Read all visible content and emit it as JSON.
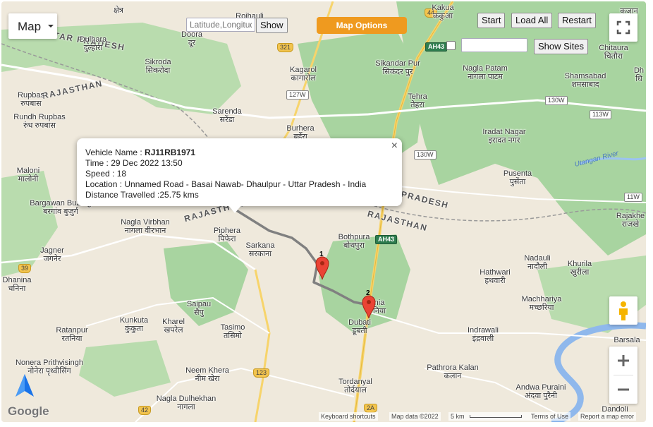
{
  "map_type": {
    "label": "Map"
  },
  "latlong_input": {
    "placeholder": "Latitude,Longitude"
  },
  "show_button": {
    "label": "Show"
  },
  "map_options_button": {
    "label": "Map Options"
  },
  "playback": {
    "start": "Start",
    "load_all": "Load All",
    "restart": "Restart"
  },
  "sites": {
    "show_sites": "Show Sites"
  },
  "info_window": {
    "vehicle_label": "Vehicle Name : ",
    "vehicle_name": "RJ11RB1971",
    "time": "Time : 29 Dec 2022 13:50",
    "speed": "Speed : 18",
    "location": "Location : Unnamed Road - Basai Nawab- Dhaulpur - Uttar Pradesh - India",
    "distance": "Distance Travelled :25.75 kms",
    "close": "×"
  },
  "markers": [
    {
      "label": "1"
    },
    {
      "label": "2"
    }
  ],
  "places": [
    {
      "en": "Dulhara",
      "hi": "दुल्हारा"
    },
    {
      "en": "Sikroda",
      "hi": "सिकरोदा"
    },
    {
      "en": "Rojhauli",
      "hi": ""
    },
    {
      "en": "Doora",
      "hi": "दूर"
    },
    {
      "en": "Kagarol",
      "hi": "कागारोल"
    },
    {
      "en": "Sikandar Pur",
      "hi": "सिकंदर पुर"
    },
    {
      "en": "Nagla Patam",
      "hi": "नागला पाटम"
    },
    {
      "en": "Chitaura",
      "hi": "चितौरा"
    },
    {
      "en": "Shamsabad",
      "hi": "शमसाबाद"
    },
    {
      "en": "Rupbas",
      "hi": "रुपबास"
    },
    {
      "en": "Rundh Rupbas",
      "hi": "रुंध रुपबास"
    },
    {
      "en": "Sarenda",
      "hi": "सरेंडा"
    },
    {
      "en": "Burhera",
      "hi": "बुर्हेरा"
    },
    {
      "en": "Tehra",
      "hi": "तेहरा"
    },
    {
      "en": "Kakua",
      "hi": "ककुआ"
    },
    {
      "en": "Iradat Nagar",
      "hi": "इरादत नगर"
    },
    {
      "en": "Pusenta",
      "hi": "पुसेंता"
    },
    {
      "en": "Maloni",
      "hi": "मालोनी"
    },
    {
      "en": "Bargawan Buzurg",
      "hi": "बरगांव बुज़ुर्ग"
    },
    {
      "en": "Nagla Virbhan",
      "hi": "नागला वीरभान"
    },
    {
      "en": "Piphera",
      "hi": "पिफेरा"
    },
    {
      "en": "Sarkana",
      "hi": "सरकाना"
    },
    {
      "en": "Bothpura",
      "hi": "बोथपुरा"
    },
    {
      "en": "Nadauli",
      "hi": "नादौली"
    },
    {
      "en": "Khurila",
      "hi": "खुरीला"
    },
    {
      "en": "Rajakhe",
      "hi": "राजखे"
    },
    {
      "en": "Jagner",
      "hi": "जगनेर"
    },
    {
      "en": "Dhanina",
      "hi": "धनिना"
    },
    {
      "en": "Hathwari",
      "hi": "हथवारी"
    },
    {
      "en": "Machhariya",
      "hi": "मच्छरिया"
    },
    {
      "en": "Kunkuta",
      "hi": "कुंकुता"
    },
    {
      "en": "Saipau",
      "hi": "सैपु"
    },
    {
      "en": "Kharel",
      "hi": "खपरेल"
    },
    {
      "en": "Tasimo",
      "hi": "तसिमो"
    },
    {
      "en": "Dubati",
      "hi": "डूबती"
    },
    {
      "en": "Indrawali",
      "hi": "इंद्रवाली"
    },
    {
      "en": "Ratanpur",
      "hi": "रतनिया"
    },
    {
      "en": "Nonera Prithvisingh",
      "hi": "नोनेरा पृथ्वीसिंग"
    },
    {
      "en": "Neem Khera",
      "hi": "नीम खेरा"
    },
    {
      "en": "Nagla Dulhekhan",
      "hi": "नागला"
    },
    {
      "en": "Tordanyal",
      "hi": "तोर्दयाल"
    },
    {
      "en": "Pathrora Kalan",
      "hi": "कलान"
    },
    {
      "en": "Andwa Puraini",
      "hi": "अंदवा पुरैनी"
    },
    {
      "en": "Barsala",
      "hi": ""
    },
    {
      "en": "Dandoli",
      "hi": ""
    },
    {
      "en": "Dh",
      "hi": "धि"
    },
    {
      "en": "",
      "hi": "क्षेत्र"
    },
    {
      "en": "",
      "hi": "कजान"
    },
    {
      "en": "nia",
      "hi": "निया"
    }
  ],
  "states": [
    "UTTAR PRADESH",
    "RAJASTHAN",
    "RAJASTHAN",
    "RAJASTHAN",
    "PRADESH"
  ],
  "roads": [
    "44",
    "321",
    "127W",
    "AH43",
    "130W",
    "113W",
    "130W",
    "11W",
    "39",
    "123",
    "42",
    "2A",
    "AH43"
  ],
  "river": "Utangan River",
  "footer": {
    "google": "Google",
    "shortcuts": "Keyboard shortcuts",
    "map_data": "Map data ©2022",
    "scale": "5 km",
    "terms": "Terms of Use",
    "report": "Report a map error"
  },
  "icons": [
    "fullscreen-icon",
    "pegman-icon",
    "zoom-in-icon",
    "zoom-out-icon",
    "dropdown-caret-icon",
    "app-logo-icon",
    "close-icon",
    "map-pin-icon"
  ],
  "colors": {
    "route": "#808080",
    "marker": "#ea4335",
    "map_options": "#ef9a1f",
    "forest": "#a8d4a0",
    "land": "#efe9dc",
    "highway": "#f7d46b"
  }
}
